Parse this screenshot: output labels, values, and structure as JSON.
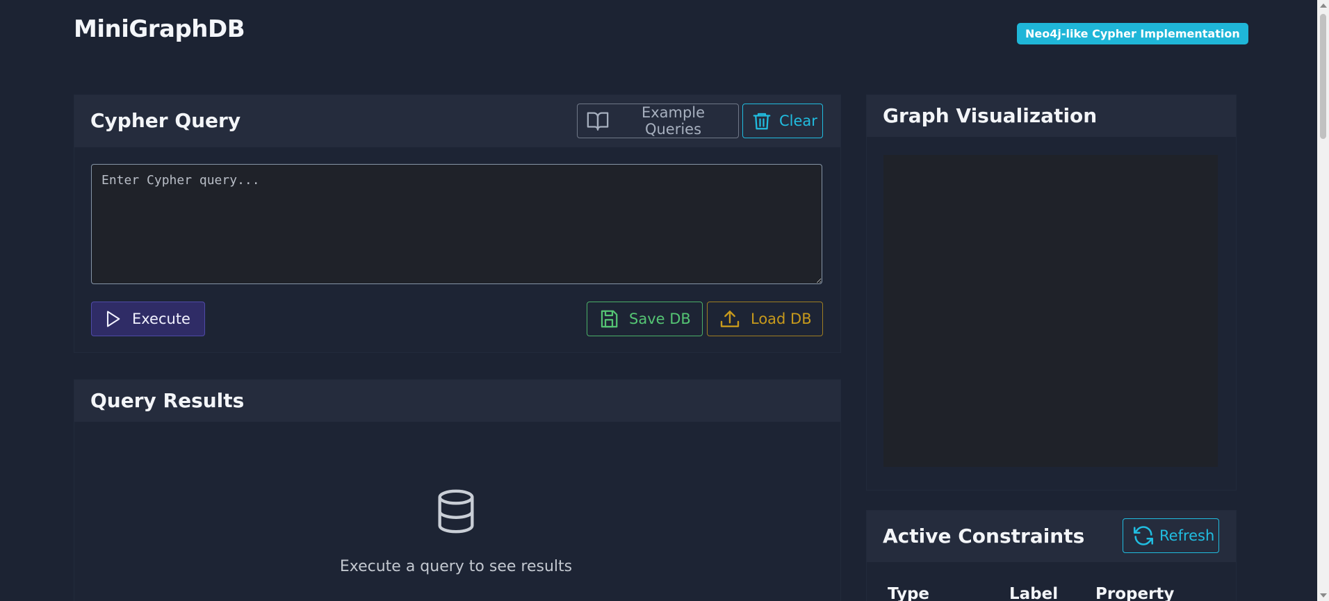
{
  "app": {
    "title": "MiniGraphDB",
    "badge": "Neo4j-like Cypher Implementation"
  },
  "query_card": {
    "title": "Cypher Query",
    "example_button": "Example Queries",
    "clear_button": "Clear",
    "input_placeholder": "Enter Cypher query...",
    "input_value": "",
    "execute_button": "Execute",
    "save_button": "Save DB",
    "load_button": "Load DB"
  },
  "results_card": {
    "title": "Query Results",
    "empty_message": "Execute a query to see results"
  },
  "viz_card": {
    "title": "Graph Visualization"
  },
  "constraints_card": {
    "title": "Active Constraints",
    "refresh_button": "Refresh",
    "columns": [
      "Type",
      "Label",
      "Property"
    ]
  },
  "icons": {
    "example": "book-open-icon",
    "clear": "trash-icon",
    "execute": "play-icon",
    "save": "floppy-disk-icon",
    "load": "upload-icon",
    "empty": "database-icon",
    "refresh": "refresh-icon"
  },
  "colors": {
    "background": "#1c2333",
    "badge": "#1fb6d8",
    "accent_cyan": "#21bde0",
    "save_green": "#55c574",
    "load_amber": "#c89a1c",
    "execute_bg": "#2f2c66"
  }
}
